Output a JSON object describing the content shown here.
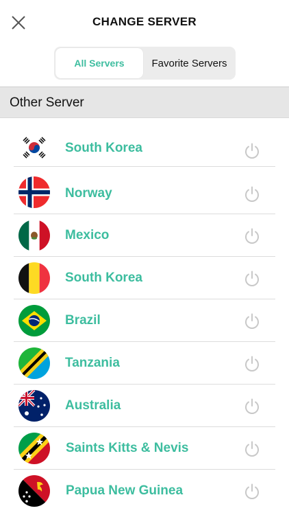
{
  "header": {
    "title": "CHANGE SERVER"
  },
  "tabs": {
    "all": "All Servers",
    "favorite": "Favorite Servers"
  },
  "section": {
    "title": "Other Server"
  },
  "colors": {
    "accent": "#3dbd9f",
    "power_icon": "#c8c8c8"
  },
  "servers": [
    {
      "name": "South Korea",
      "flag": "south-korea-flag-icon"
    },
    {
      "name": "Norway",
      "flag": "norway-flag-icon"
    },
    {
      "name": "Mexico",
      "flag": "mexico-flag-icon"
    },
    {
      "name": "South Korea",
      "flag": "belgium-flag-icon"
    },
    {
      "name": "Brazil",
      "flag": "brazil-flag-icon"
    },
    {
      "name": "Tanzania",
      "flag": "tanzania-flag-icon"
    },
    {
      "name": "Australia",
      "flag": "australia-flag-icon"
    },
    {
      "name": "Saints Kitts & Nevis",
      "flag": "saint-kitts-nevis-flag-icon"
    },
    {
      "name": "Papua New Guinea",
      "flag": "papua-new-guinea-flag-icon"
    }
  ]
}
